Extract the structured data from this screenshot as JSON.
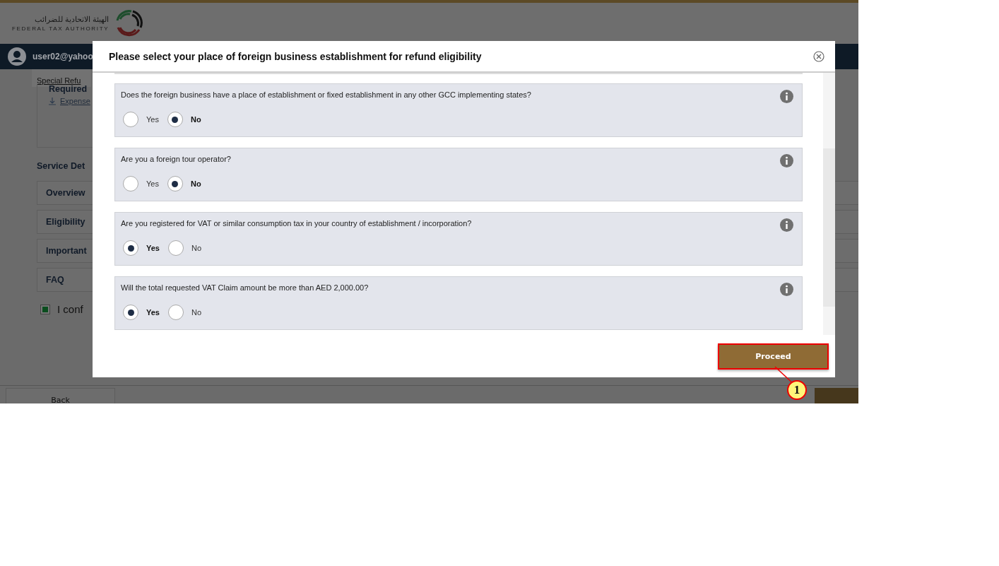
{
  "header": {
    "logo_arabic": "الهيئة الاتحادية للضرائب",
    "logo_english": "FEDERAL TAX AUTHORITY"
  },
  "nav": {
    "user": "user02@yahoo"
  },
  "breadcrumb": "Special Refu",
  "required": {
    "title": "Required",
    "link": "Expense"
  },
  "service_details": {
    "title": "Service Det",
    "sections": [
      "Overview",
      "Eligibility",
      "Important",
      "FAQ"
    ]
  },
  "confirm": {
    "label": "I conf",
    "checked": true
  },
  "footer": {
    "back": "Back"
  },
  "modal": {
    "title": "Please select your place of foreign business establishment for refund eligibility",
    "questions": [
      {
        "text": "Does the foreign business have a place of establishment or fixed establishment in any other GCC implementing states?",
        "options": [
          {
            "label": "Yes",
            "selected": false
          },
          {
            "label": "No",
            "selected": true
          }
        ]
      },
      {
        "text": "Are you a foreign tour operator?",
        "options": [
          {
            "label": "Yes",
            "selected": false
          },
          {
            "label": "No",
            "selected": true
          }
        ]
      },
      {
        "text": "Are you registered for VAT or similar consumption tax in your country of establishment / incorporation?",
        "options": [
          {
            "label": "Yes",
            "selected": true
          },
          {
            "label": "No",
            "selected": false
          }
        ]
      },
      {
        "text": "Will the total requested VAT Claim amount be more than AED 2,000.00?",
        "options": [
          {
            "label": "Yes",
            "selected": true
          },
          {
            "label": "No",
            "selected": false
          }
        ]
      }
    ],
    "proceed": "Proceed"
  },
  "annotation": {
    "number": "1"
  }
}
